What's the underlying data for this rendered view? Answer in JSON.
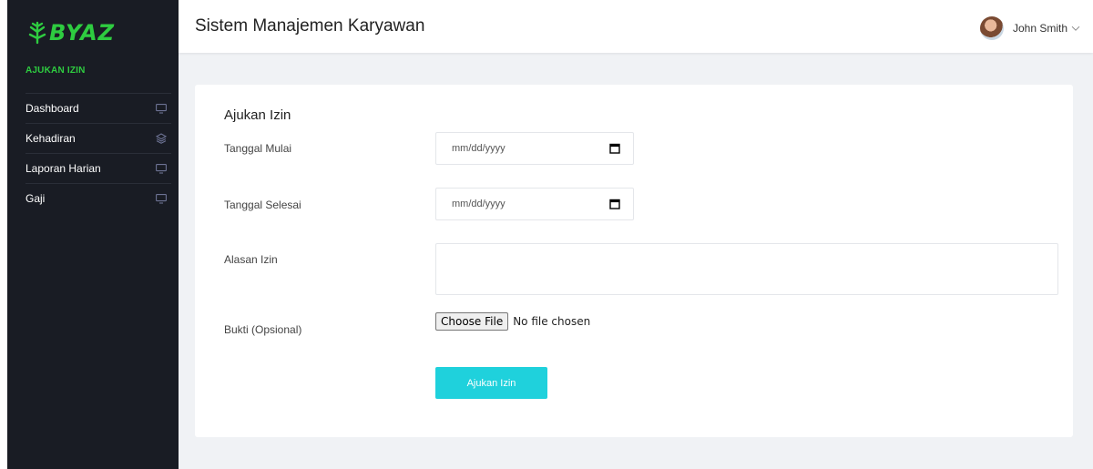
{
  "colors": {
    "accent": "#2ecc40",
    "sidebar_bg": "#191c24",
    "button": "#1fd1dc"
  },
  "brand": {
    "logo_text": "BYAZ",
    "logo_icon": "leaf-icon"
  },
  "sidebar": {
    "section_title": "AJUKAN IZIN",
    "items": [
      {
        "label": "Dashboard",
        "icon": "monitor-icon"
      },
      {
        "label": "Kehadiran",
        "icon": "layers-icon"
      },
      {
        "label": "Laporan Harian",
        "icon": "monitor-icon"
      },
      {
        "label": "Gaji",
        "icon": "monitor-icon"
      }
    ]
  },
  "header": {
    "title": "Sistem Manajemen Karyawan",
    "user_name": "John Smith",
    "user_icon": "chevron-down-icon"
  },
  "form": {
    "title": "Ajukan Izin",
    "start_date": {
      "label": "Tanggal Mulai",
      "placeholder": "mm/dd/yyyy"
    },
    "end_date": {
      "label": "Tanggal Selesai",
      "placeholder": "mm/dd/yyyy"
    },
    "reason": {
      "label": "Alasan Izin",
      "value": ""
    },
    "proof": {
      "label": "Bukti (Opsional)",
      "button": "Choose File",
      "status": "No file chosen"
    },
    "submit_label": "Ajukan Izin"
  }
}
